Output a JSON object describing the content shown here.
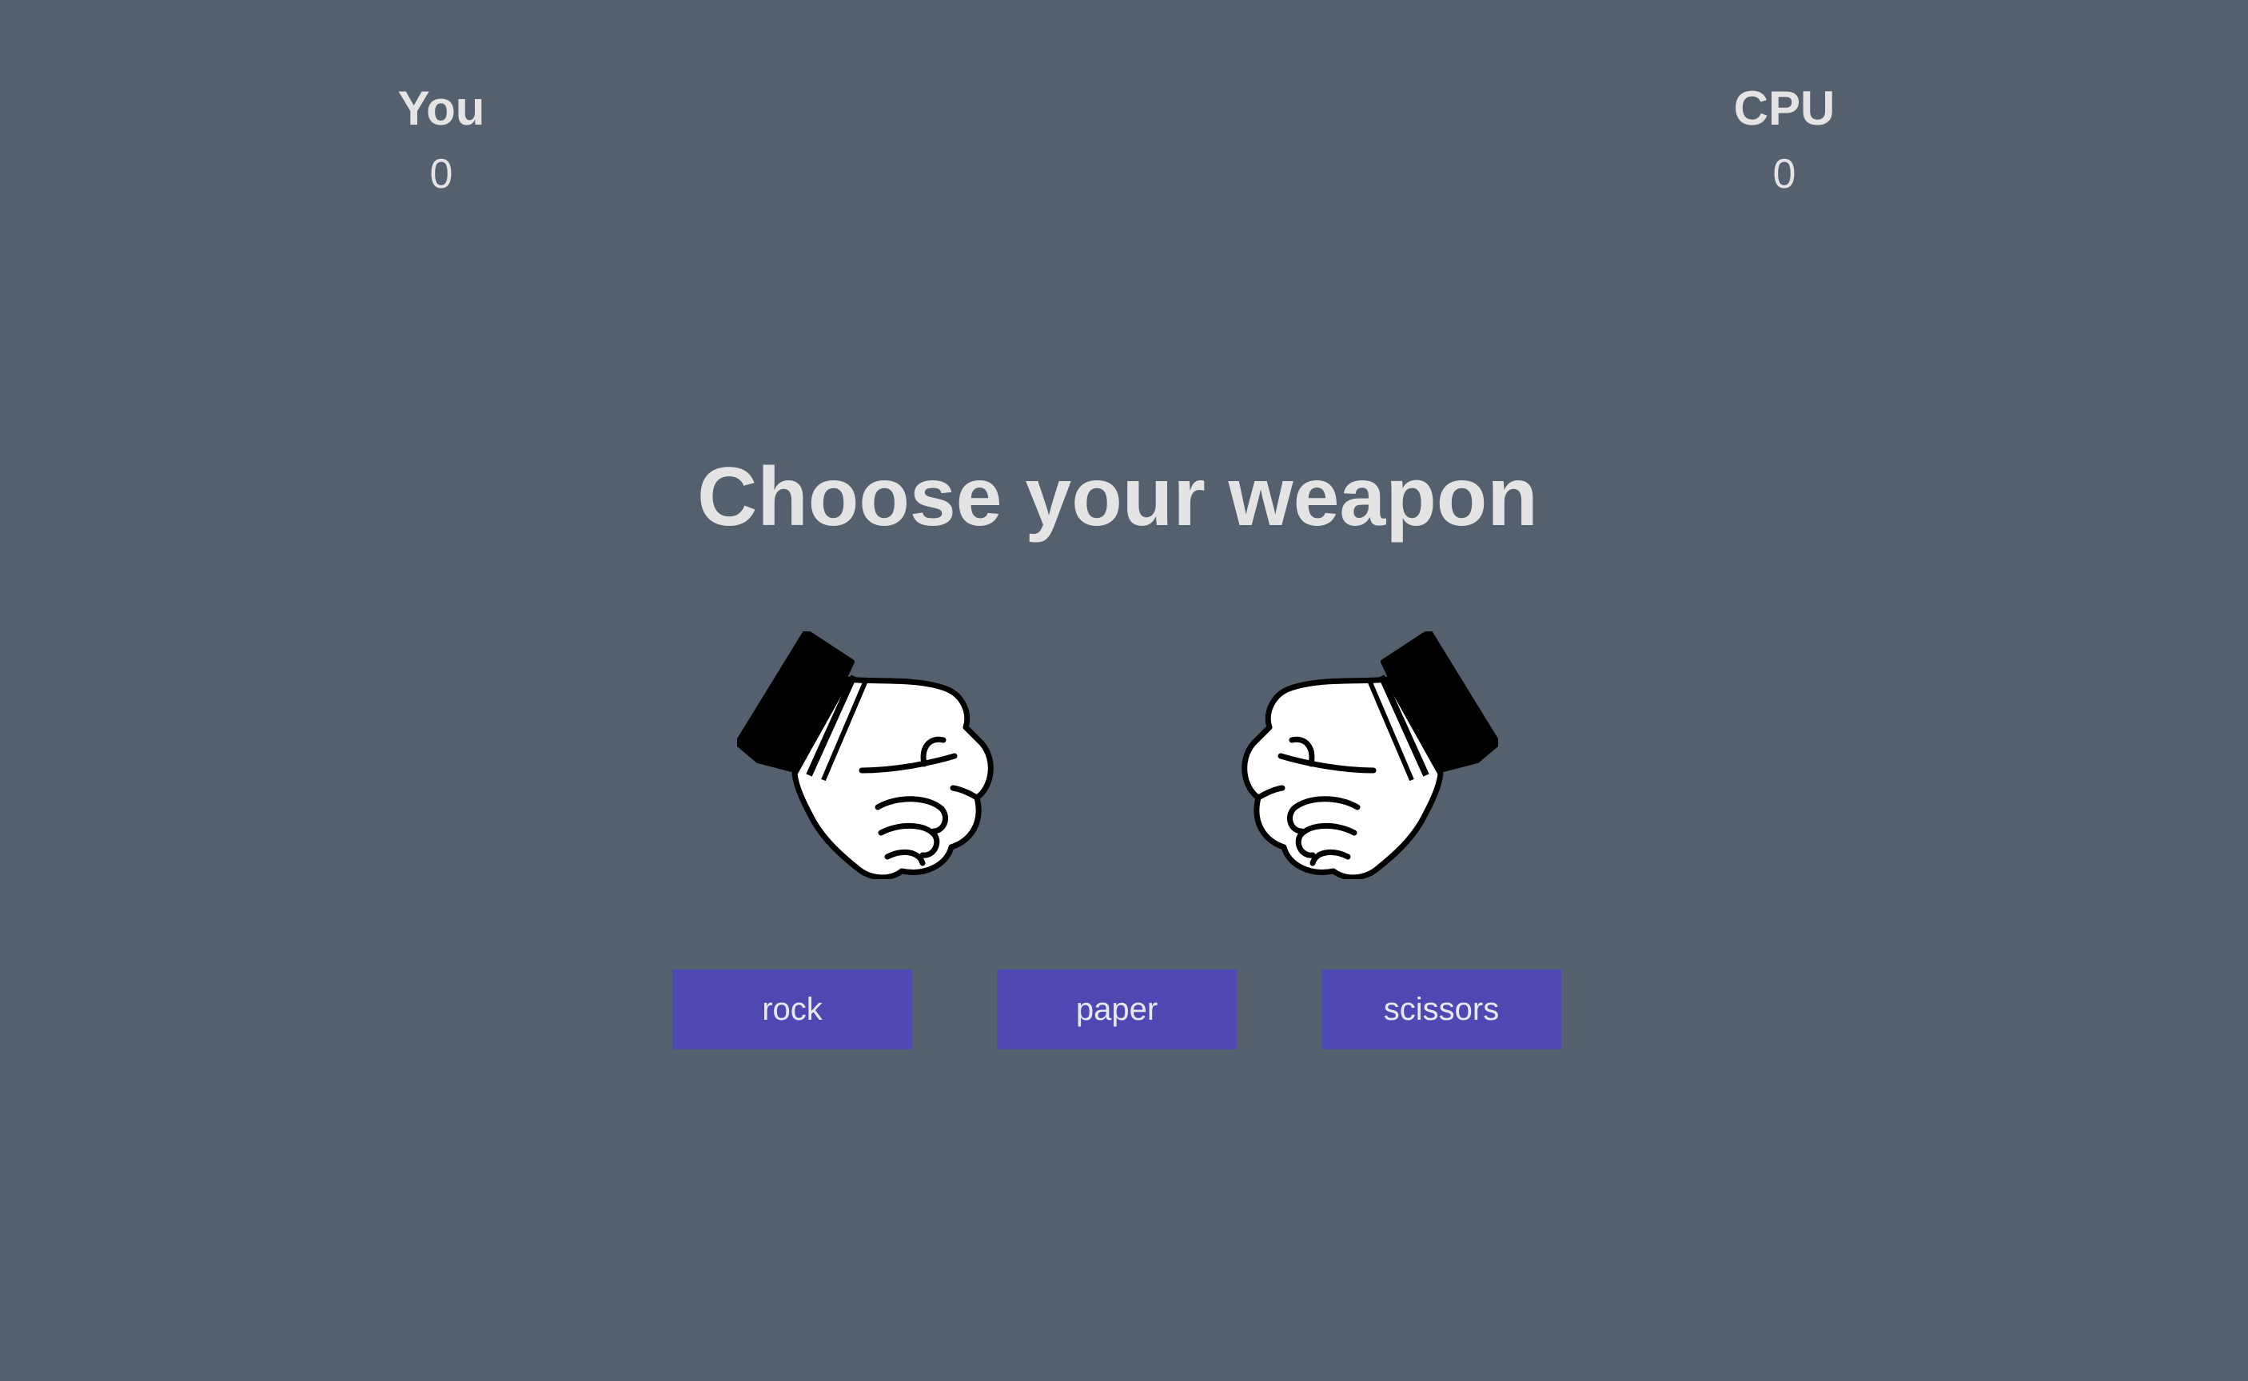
{
  "scoreboard": {
    "player": {
      "label": "You",
      "score": "0"
    },
    "cpu": {
      "label": "CPU",
      "score": "0"
    }
  },
  "heading": "Choose your weapon",
  "hands": {
    "player": {
      "icon": "fist-icon"
    },
    "cpu": {
      "icon": "fist-icon"
    }
  },
  "weapons": {
    "rock": "rock",
    "paper": "paper",
    "scissors": "scissors"
  },
  "colors": {
    "background": "#54606e",
    "button": "#5048b2",
    "text": "#e4e4e4"
  }
}
